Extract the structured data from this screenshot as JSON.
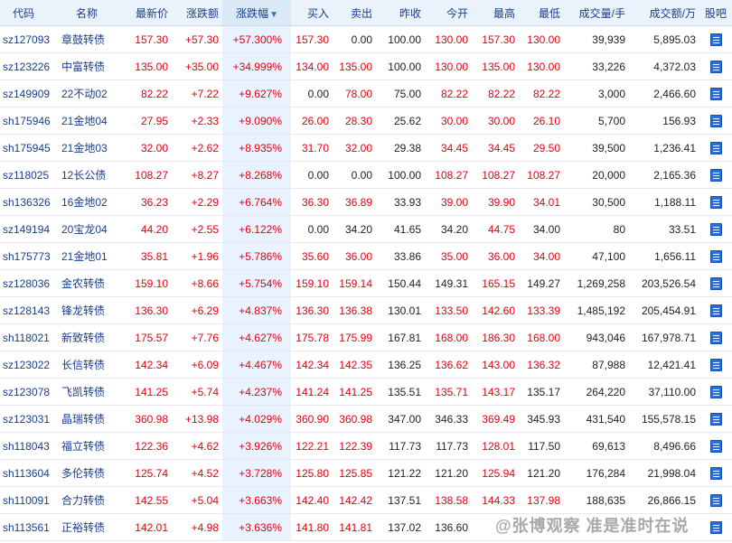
{
  "columns": [
    {
      "key": "code",
      "label": "代码"
    },
    {
      "key": "name",
      "label": "名称"
    },
    {
      "key": "last",
      "label": "最新价"
    },
    {
      "key": "chg",
      "label": "涨跌额"
    },
    {
      "key": "pct",
      "label": "涨跌幅"
    },
    {
      "key": "buy",
      "label": "买入"
    },
    {
      "key": "sell",
      "label": "卖出"
    },
    {
      "key": "prev",
      "label": "昨收"
    },
    {
      "key": "open",
      "label": "今开"
    },
    {
      "key": "high",
      "label": "最高"
    },
    {
      "key": "low",
      "label": "最低"
    },
    {
      "key": "vol",
      "label": "成交量/手"
    },
    {
      "key": "amt",
      "label": "成交额/万"
    },
    {
      "key": "gb",
      "label": "股吧"
    }
  ],
  "sorted_column": "pct",
  "sort_direction": "desc",
  "colors": {
    "up": "#e60012",
    "link": "#1a3e8c",
    "header_bg": "#eaf2fb",
    "sorted_col_bg": "#e8f3ff"
  },
  "rows": [
    {
      "code": "sz127093",
      "name": "章鼓转债",
      "last": "157.30",
      "chg": "+57.30",
      "pct": "+57.300%",
      "buy": "157.30",
      "sell": "0.00",
      "prev": "100.00",
      "open": "130.00",
      "high": "157.30",
      "low": "130.00",
      "vol": "39,939",
      "amt": "5,895.03"
    },
    {
      "code": "sz123226",
      "name": "中富转债",
      "last": "135.00",
      "chg": "+35.00",
      "pct": "+34.999%",
      "buy": "134.00",
      "sell": "135.00",
      "prev": "100.00",
      "open": "130.00",
      "high": "135.00",
      "low": "130.00",
      "vol": "33,226",
      "amt": "4,372.03"
    },
    {
      "code": "sz149909",
      "name": "22不动02",
      "last": "82.22",
      "chg": "+7.22",
      "pct": "+9.627%",
      "buy": "0.00",
      "sell": "78.00",
      "prev": "75.00",
      "open": "82.22",
      "high": "82.22",
      "low": "82.22",
      "vol": "3,000",
      "amt": "2,466.60"
    },
    {
      "code": "sh175946",
      "name": "21金地04",
      "last": "27.95",
      "chg": "+2.33",
      "pct": "+9.090%",
      "buy": "26.00",
      "sell": "28.30",
      "prev": "25.62",
      "open": "30.00",
      "high": "30.00",
      "low": "26.10",
      "vol": "5,700",
      "amt": "156.93"
    },
    {
      "code": "sh175945",
      "name": "21金地03",
      "last": "32.00",
      "chg": "+2.62",
      "pct": "+8.935%",
      "buy": "31.70",
      "sell": "32.00",
      "prev": "29.38",
      "open": "34.45",
      "high": "34.45",
      "low": "29.50",
      "vol": "39,500",
      "amt": "1,236.41"
    },
    {
      "code": "sz118025",
      "name": "12长公债",
      "last": "108.27",
      "chg": "+8.27",
      "pct": "+8.268%",
      "buy": "0.00",
      "sell": "0.00",
      "prev": "100.00",
      "open": "108.27",
      "high": "108.27",
      "low": "108.27",
      "vol": "20,000",
      "amt": "2,165.36"
    },
    {
      "code": "sh136326",
      "name": "16金地02",
      "last": "36.23",
      "chg": "+2.29",
      "pct": "+6.764%",
      "buy": "36.30",
      "sell": "36.89",
      "prev": "33.93",
      "open": "39.00",
      "high": "39.90",
      "low": "34.01",
      "vol": "30,500",
      "amt": "1,188.11"
    },
    {
      "code": "sz149194",
      "name": "20宝龙04",
      "last": "44.20",
      "chg": "+2.55",
      "pct": "+6.122%",
      "buy": "0.00",
      "sell": "34.20",
      "prev": "41.65",
      "open": "34.20",
      "high": "44.75",
      "low": "34.00",
      "vol": "80",
      "amt": "33.51"
    },
    {
      "code": "sh175773",
      "name": "21金地01",
      "last": "35.81",
      "chg": "+1.96",
      "pct": "+5.786%",
      "buy": "35.60",
      "sell": "36.00",
      "prev": "33.86",
      "open": "35.00",
      "high": "36.00",
      "low": "34.00",
      "vol": "47,100",
      "amt": "1,656.11"
    },
    {
      "code": "sz128036",
      "name": "金农转债",
      "last": "159.10",
      "chg": "+8.66",
      "pct": "+5.754%",
      "buy": "159.10",
      "sell": "159.14",
      "prev": "150.44",
      "open": "149.31",
      "high": "165.15",
      "low": "149.27",
      "vol": "1,269,258",
      "amt": "203,526.54"
    },
    {
      "code": "sz128143",
      "name": "锋龙转债",
      "last": "136.30",
      "chg": "+6.29",
      "pct": "+4.837%",
      "buy": "136.30",
      "sell": "136.38",
      "prev": "130.01",
      "open": "133.50",
      "high": "142.60",
      "low": "133.39",
      "vol": "1,485,192",
      "amt": "205,454.91"
    },
    {
      "code": "sh118021",
      "name": "新致转债",
      "last": "175.57",
      "chg": "+7.76",
      "pct": "+4.627%",
      "buy": "175.78",
      "sell": "175.99",
      "prev": "167.81",
      "open": "168.00",
      "high": "186.30",
      "low": "168.00",
      "vol": "943,046",
      "amt": "167,978.71"
    },
    {
      "code": "sz123022",
      "name": "长信转债",
      "last": "142.34",
      "chg": "+6.09",
      "pct": "+4.467%",
      "buy": "142.34",
      "sell": "142.35",
      "prev": "136.25",
      "open": "136.62",
      "high": "143.00",
      "low": "136.32",
      "vol": "87,988",
      "amt": "12,421.41"
    },
    {
      "code": "sz123078",
      "name": "飞凯转债",
      "last": "141.25",
      "chg": "+5.74",
      "pct": "+4.237%",
      "buy": "141.24",
      "sell": "141.25",
      "prev": "135.51",
      "open": "135.71",
      "high": "143.17",
      "low": "135.17",
      "vol": "264,220",
      "amt": "37,110.00"
    },
    {
      "code": "sz123031",
      "name": "晶瑞转债",
      "last": "360.98",
      "chg": "+13.98",
      "pct": "+4.029%",
      "buy": "360.90",
      "sell": "360.98",
      "prev": "347.00",
      "open": "346.33",
      "high": "369.49",
      "low": "345.93",
      "vol": "431,540",
      "amt": "155,578.15"
    },
    {
      "code": "sh118043",
      "name": "福立转债",
      "last": "122.36",
      "chg": "+4.62",
      "pct": "+3.926%",
      "buy": "122.21",
      "sell": "122.39",
      "prev": "117.73",
      "open": "117.73",
      "high": "128.01",
      "low": "117.50",
      "vol": "69,613",
      "amt": "8,496.66"
    },
    {
      "code": "sh113604",
      "name": "多伦转债",
      "last": "125.74",
      "chg": "+4.52",
      "pct": "+3.728%",
      "buy": "125.80",
      "sell": "125.85",
      "prev": "121.22",
      "open": "121.20",
      "high": "125.94",
      "low": "121.20",
      "vol": "176,284",
      "amt": "21,998.04"
    },
    {
      "code": "sh110091",
      "name": "合力转债",
      "last": "142.55",
      "chg": "+5.04",
      "pct": "+3.663%",
      "buy": "142.40",
      "sell": "142.42",
      "prev": "137.51",
      "open": "138.58",
      "high": "144.33",
      "low": "137.98",
      "vol": "188,635",
      "amt": "26,866.15"
    },
    {
      "code": "sh113561",
      "name": "正裕转债",
      "last": "142.01",
      "chg": "+4.98",
      "pct": "+3.636%",
      "buy": "141.80",
      "sell": "141.81",
      "prev": "137.02",
      "open": "136.60",
      "high": "",
      "low": "",
      "vol": "",
      "amt": ""
    }
  ],
  "watermark": "@张博观察 准是准时在说"
}
